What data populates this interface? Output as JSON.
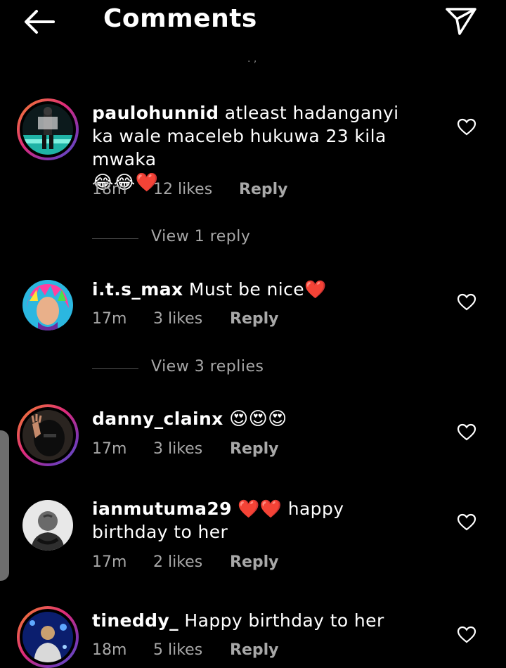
{
  "header": {
    "title": "Comments"
  },
  "loader_dots": ". ,",
  "comments": [
    {
      "username": "paulohunnid",
      "text": "atleast hadanganyi ka wale maceleb hukuwa 23 kila mwaka",
      "emojis": "😂😂❤️",
      "time": "18m",
      "likes": "12 likes",
      "reply": "Reply",
      "view_replies": "View 1 reply"
    },
    {
      "username": "i.t.s_max",
      "text": "Must be nice❤️",
      "time": "17m",
      "likes": "3 likes",
      "reply": "Reply",
      "view_replies": "View 3 replies"
    },
    {
      "username": "danny_clainx",
      "text": "😍😍😍",
      "time": "17m",
      "likes": "3 likes",
      "reply": "Reply"
    },
    {
      "username": "ianmutuma29",
      "text": "❤️❤️ happy birthday to her",
      "time": "17m",
      "likes": "2 likes",
      "reply": "Reply"
    },
    {
      "username": "tineddy_",
      "text": "Happy birthday to her",
      "time": "18m",
      "likes": "5 likes",
      "reply": "Reply"
    }
  ],
  "icons": {
    "back": "arrow-left-icon",
    "send": "paper-plane-icon",
    "like": "heart-outline-icon"
  },
  "colors": {
    "background": "#000000",
    "text": "#ffffff",
    "muted": "#a8a8a8",
    "story_ring_start": "#f58529",
    "story_ring_end": "#515bd4"
  }
}
